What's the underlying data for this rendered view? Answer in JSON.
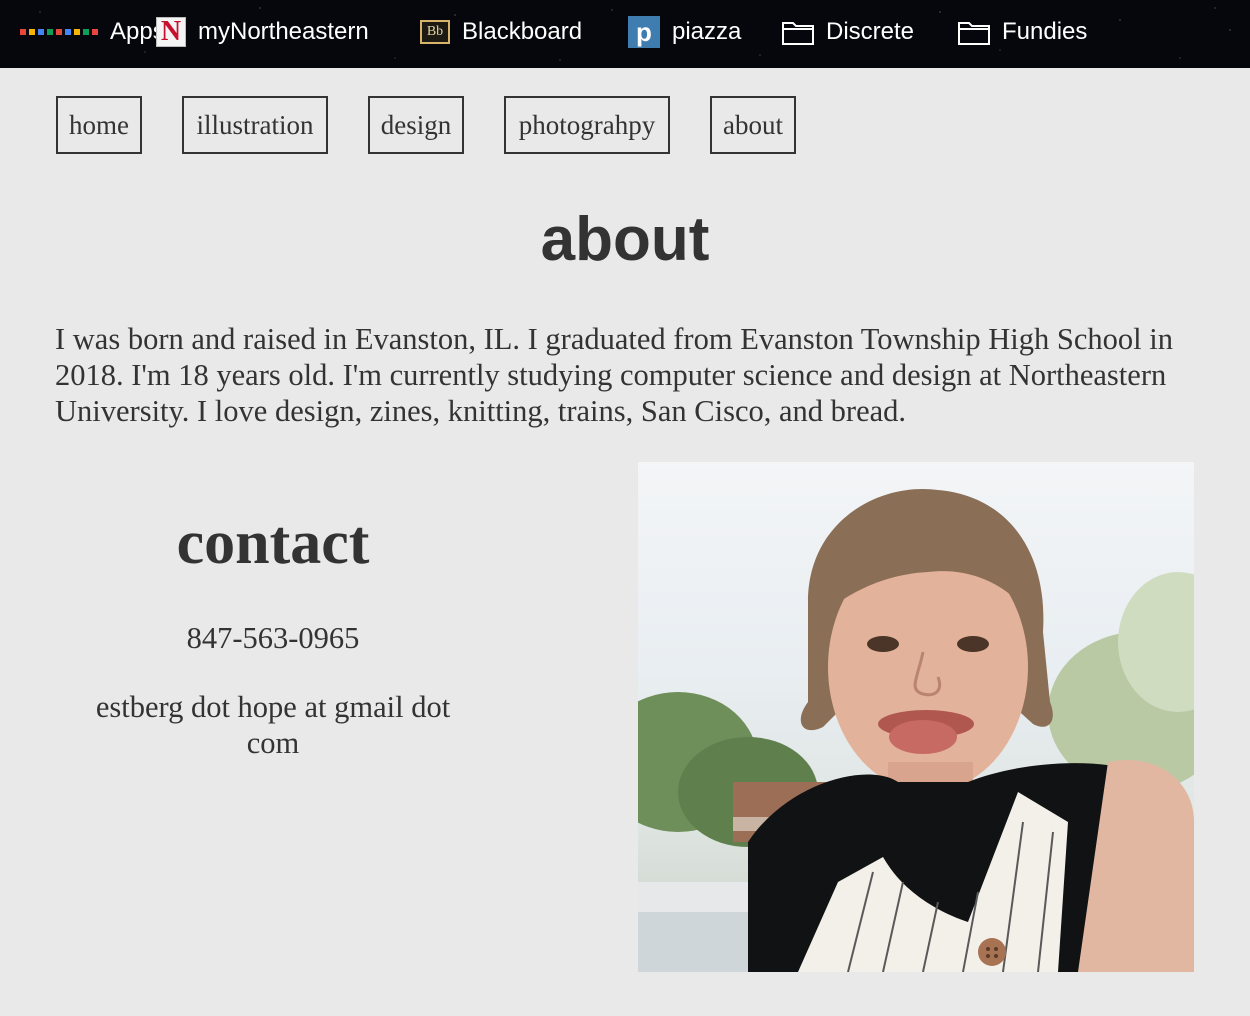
{
  "bookmarks": [
    {
      "label": "Apps",
      "icon": "apps-grid-icon"
    },
    {
      "label": "myNortheastern",
      "icon": "northeastern-n-icon",
      "icon_text": "N"
    },
    {
      "label": "Blackboard",
      "icon": "blackboard-bb-icon",
      "icon_text": "Bb"
    },
    {
      "label": "piazza",
      "icon": "piazza-p-icon",
      "icon_text": "p"
    },
    {
      "label": "Discrete",
      "icon": "folder-icon"
    },
    {
      "label": "Fundies",
      "icon": "folder-icon"
    }
  ],
  "nav": {
    "home": "home",
    "illustration": "illustration",
    "design": "design",
    "photography": "photograhpy",
    "about": "about"
  },
  "page": {
    "title": "about",
    "bio": "I was born and raised in Evanston, IL. I graduated from Evanston Township High School in 2018. I'm 18 years old. I'm currently studying computer science and design at Northeastern University. I love design, zines, knitting, trains, San Cisco, and bread."
  },
  "contact": {
    "title": "contact",
    "phone": "847-563-0965",
    "email": "estberg dot hope at gmail dot com"
  },
  "colors": {
    "page_background": "#e9e9e9",
    "text": "#333333",
    "bookmarks_bar": "#05070c"
  }
}
